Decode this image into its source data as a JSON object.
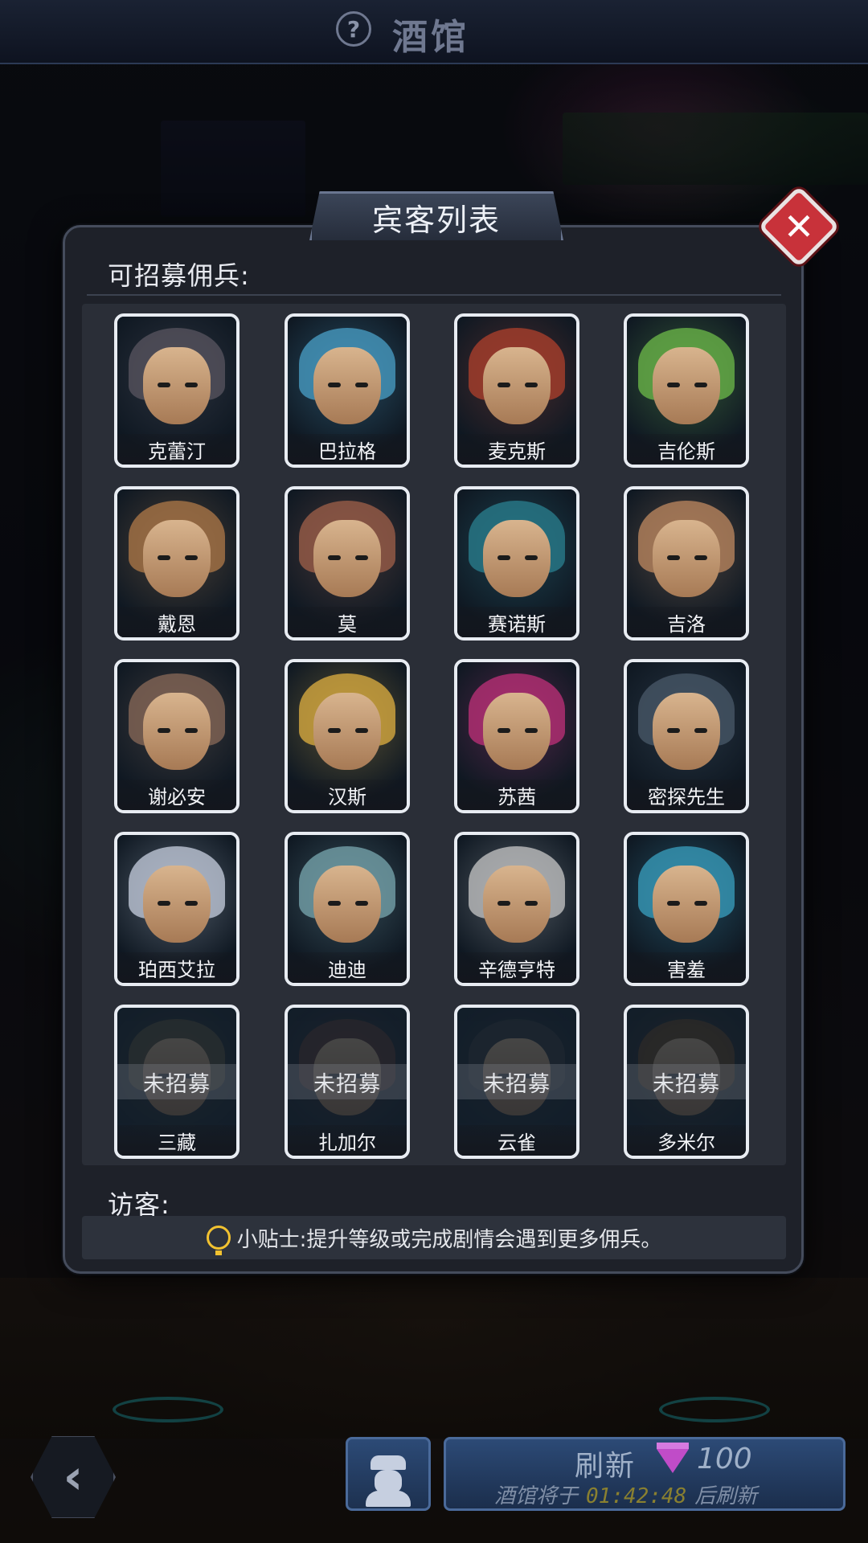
{
  "topbar": {
    "help_glyph": "?",
    "title": "酒馆"
  },
  "dialog": {
    "title": "宾客列表",
    "recruitable_label": "可招募佣兵:",
    "visitor_label": "访客:",
    "tip": "小贴士:提升等级或完成剧情会遇到更多佣兵。",
    "locked_text": "未招募",
    "mercenaries": [
      {
        "name": "克蕾汀",
        "recruited": true,
        "color": "#5a5560"
      },
      {
        "name": "巴拉格",
        "recruited": true,
        "color": "#4aa0c8"
      },
      {
        "name": "麦克斯",
        "recruited": true,
        "color": "#b0402c"
      },
      {
        "name": "吉伦斯",
        "recruited": true,
        "color": "#6dbb4a"
      },
      {
        "name": "戴恩",
        "recruited": true,
        "color": "#b07a48"
      },
      {
        "name": "莫",
        "recruited": true,
        "color": "#a0604a"
      },
      {
        "name": "赛诺斯",
        "recruited": true,
        "color": "#2a8090"
      },
      {
        "name": "吉洛",
        "recruited": true,
        "color": "#c08a60"
      },
      {
        "name": "谢必安",
        "recruited": true,
        "color": "#8a6a58"
      },
      {
        "name": "汉斯",
        "recruited": true,
        "color": "#e0b040"
      },
      {
        "name": "苏茜",
        "recruited": true,
        "color": "#c0307a"
      },
      {
        "name": "密探先生",
        "recruited": true,
        "color": "#4a5a6a"
      },
      {
        "name": "珀西艾拉",
        "recruited": true,
        "color": "#c8d0e0"
      },
      {
        "name": "迪迪",
        "recruited": true,
        "color": "#7aa8b0"
      },
      {
        "name": "辛德亨特",
        "recruited": true,
        "color": "#c8c8c8"
      },
      {
        "name": "害羞",
        "recruited": true,
        "color": "#3aa0c0"
      },
      {
        "name": "三藏",
        "recruited": false,
        "color": "#6a5a3a"
      },
      {
        "name": "扎加尔",
        "recruited": false,
        "color": "#6a3a2a"
      },
      {
        "name": "云雀",
        "recruited": false,
        "color": "#3a3a3a"
      },
      {
        "name": "多米尔",
        "recruited": false,
        "color": "#7a4a1a"
      }
    ]
  },
  "bottom": {
    "back_glyph": "‹",
    "refresh_label": "刷新",
    "refresh_cost": "100",
    "countdown_prefix": "酒馆将于",
    "countdown_time": "01:42:48",
    "countdown_suffix": "后刷新"
  },
  "icons": [
    "help-icon",
    "close-icon",
    "bulb-icon",
    "gem-icon",
    "spy-icon",
    "back-arrow-icon"
  ]
}
